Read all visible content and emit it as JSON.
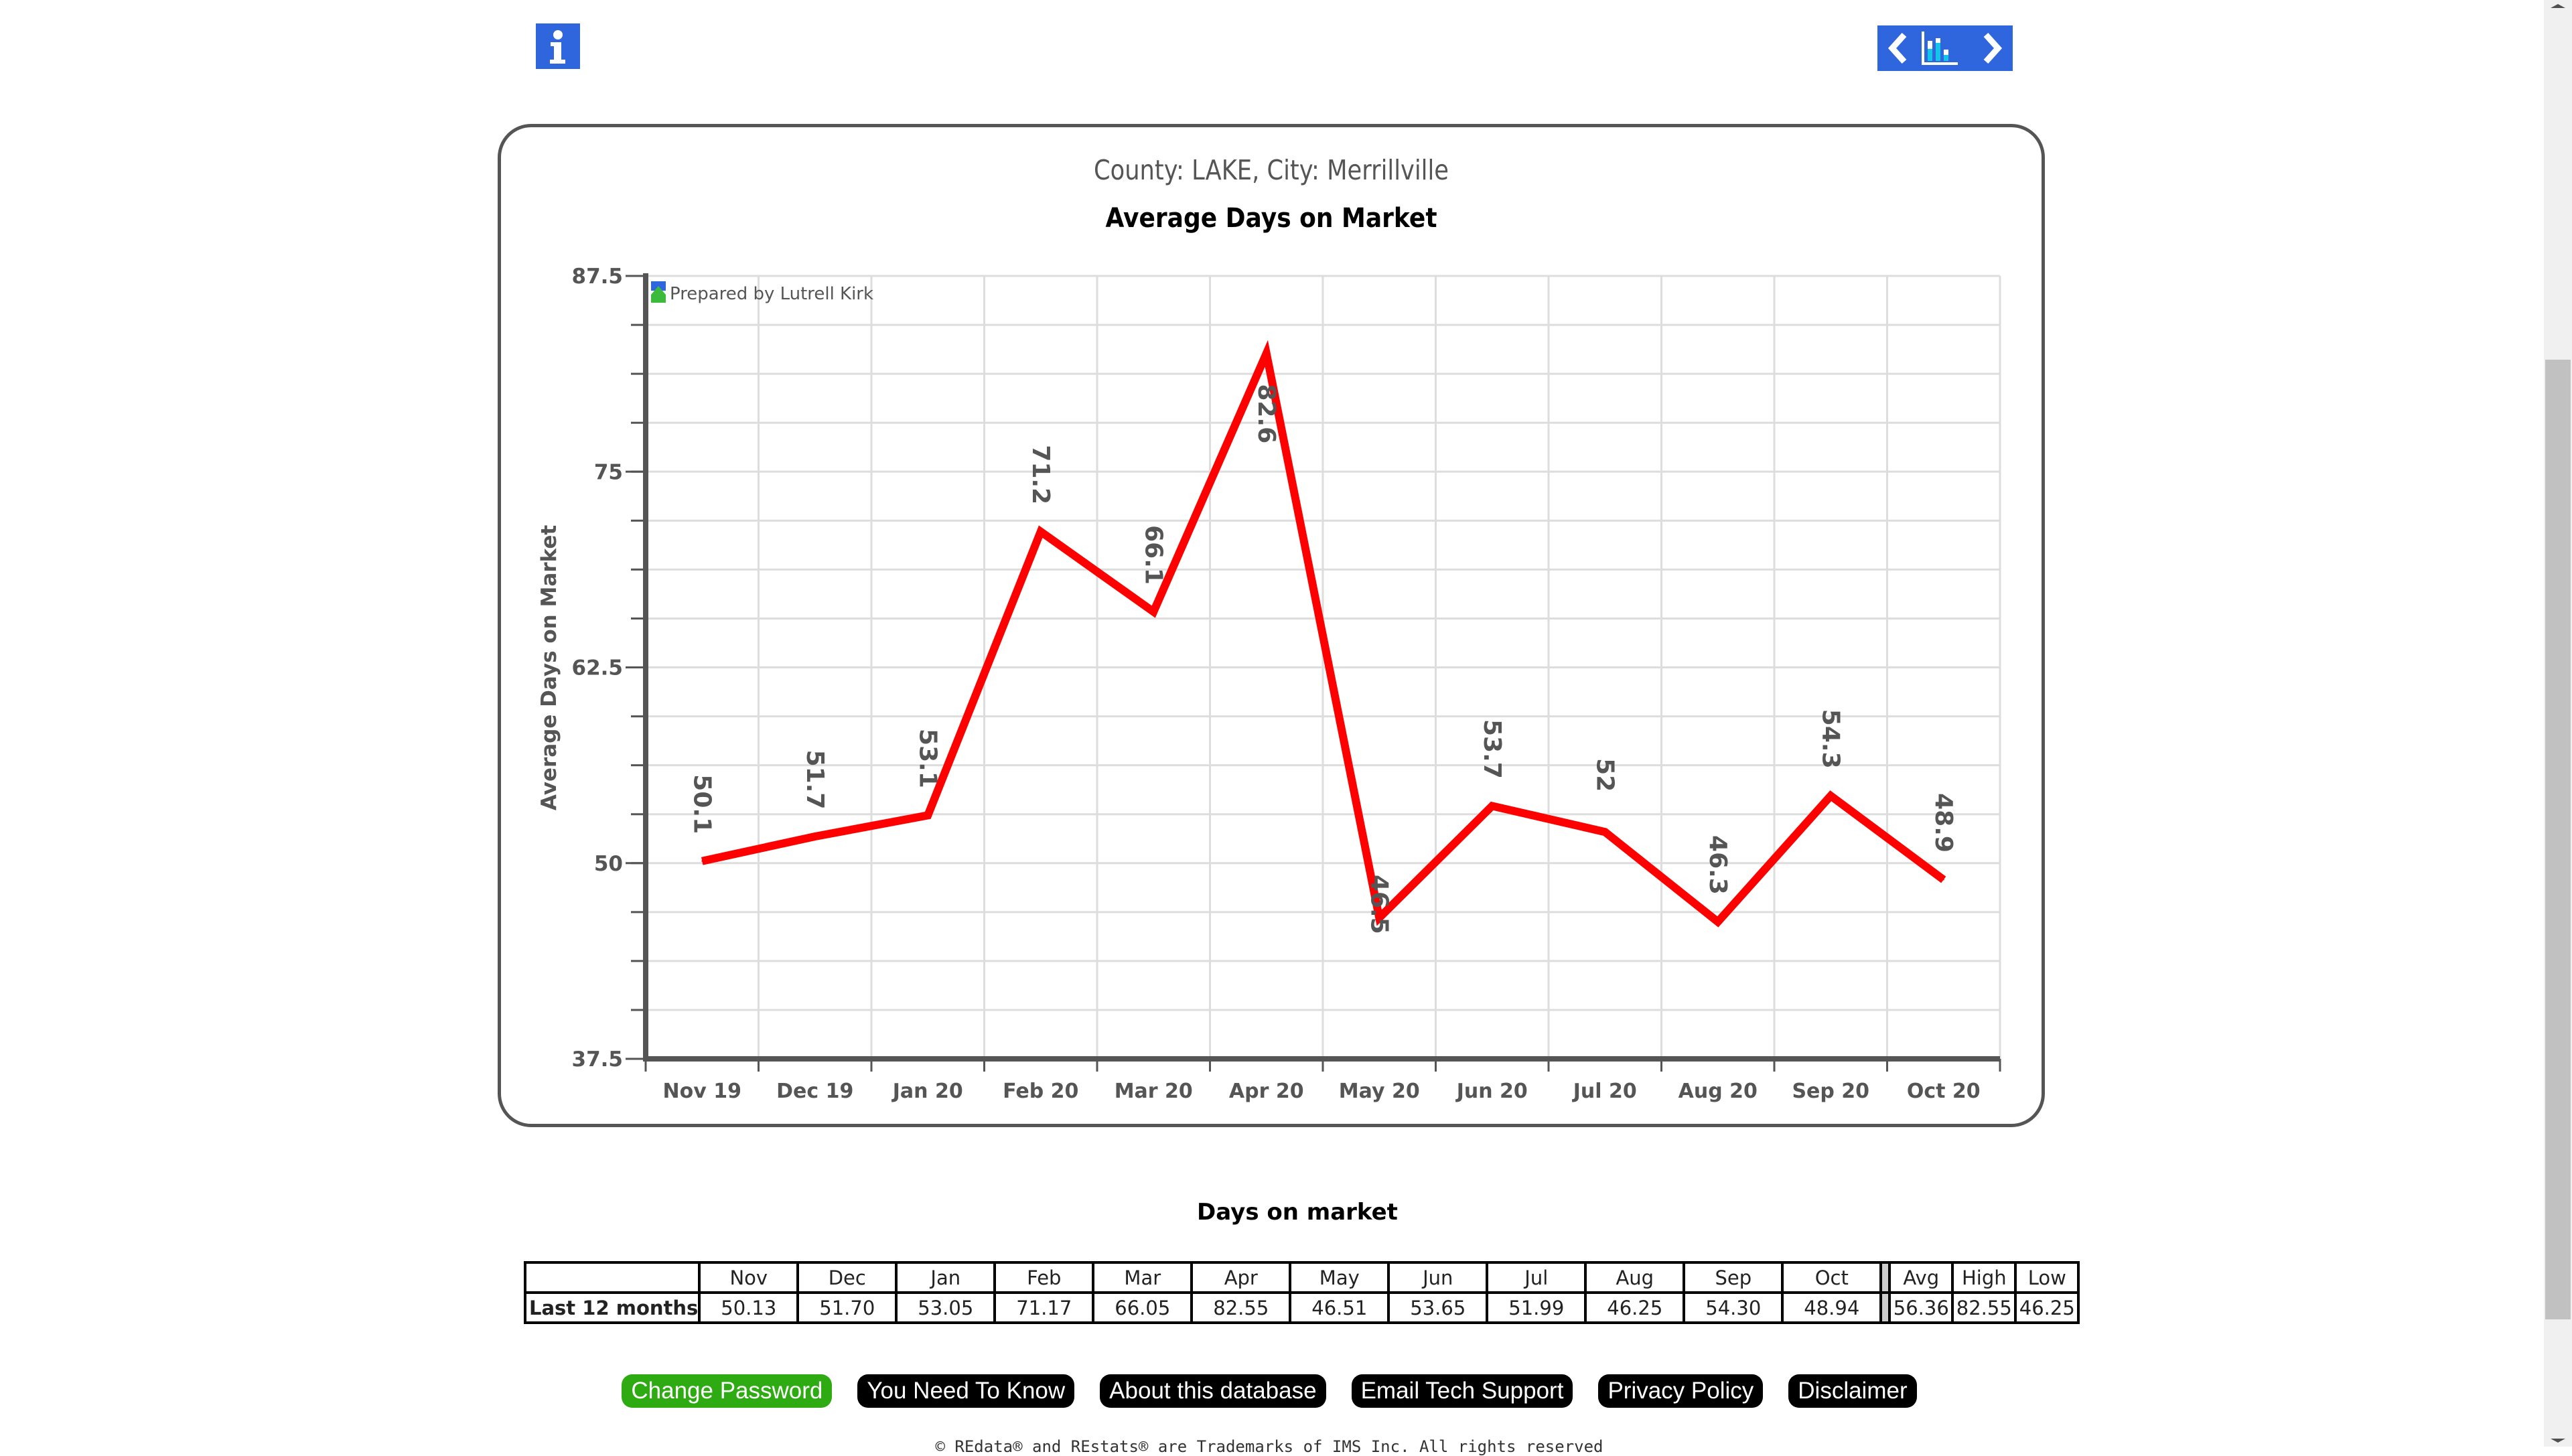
{
  "header": {
    "info_icon": "info-icon",
    "nav": {
      "prev_icon": "chevron-left-icon",
      "chart_icon": "bar-chart-icon",
      "next_icon": "chevron-right-icon"
    }
  },
  "chart_data": {
    "type": "line",
    "subtitle": "County: LAKE, City: Merrillville",
    "title": "Average Days on Market",
    "watermark": "Prepared by Lutrell Kirk",
    "xlabel": "",
    "ylabel": "Average Days on Market",
    "categories": [
      "Nov 19",
      "Dec 19",
      "Jan 20",
      "Feb 20",
      "Mar 20",
      "Apr 20",
      "May 20",
      "Jun 20",
      "Jul 20",
      "Aug 20",
      "Sep 20",
      "Oct 20"
    ],
    "series": [
      {
        "name": "Average Days on Market",
        "color": "#ff0000",
        "values": [
          50.13,
          51.7,
          53.05,
          71.17,
          66.05,
          82.55,
          46.51,
          53.65,
          51.99,
          46.25,
          54.3,
          48.94
        ],
        "labels": [
          "50.1",
          "51.7",
          "53.1",
          "71.2",
          "66.1",
          "82.6",
          "46.5",
          "53.7",
          "52",
          "46.3",
          "54.3",
          "48.9"
        ]
      }
    ],
    "ylim": [
      37.5,
      87.5
    ],
    "yticks": [
      37.5,
      50,
      62.5,
      75,
      87.5
    ],
    "ytick_labels": [
      "37.5",
      "50",
      "62.5",
      "75",
      "87.5"
    ],
    "minor_grid_step": 3.125,
    "grid": true,
    "legend": "none"
  },
  "table": {
    "title": "Days on market",
    "months": [
      "Nov",
      "Dec",
      "Jan",
      "Feb",
      "Mar",
      "Apr",
      "May",
      "Jun",
      "Jul",
      "Aug",
      "Sep",
      "Oct"
    ],
    "stat_headers": [
      "Avg",
      "High",
      "Low"
    ],
    "rows": [
      {
        "label": "Last 12 months",
        "values": [
          "50.13",
          "51.70",
          "53.05",
          "71.17",
          "66.05",
          "82.55",
          "46.51",
          "53.65",
          "51.99",
          "46.25",
          "54.30",
          "48.94"
        ],
        "stats": [
          "56.36",
          "82.55",
          "46.25"
        ]
      }
    ]
  },
  "footer": {
    "buttons": [
      {
        "label": "Change Password",
        "style": "green"
      },
      {
        "label": "You Need To Know",
        "style": "black"
      },
      {
        "label": "About this database",
        "style": "black"
      },
      {
        "label": "Email Tech Support",
        "style": "black"
      },
      {
        "label": "Privacy Policy",
        "style": "black"
      },
      {
        "label": "Disclaimer",
        "style": "black"
      }
    ],
    "copyright": "© REdata® and REstats® are Trademarks of IMS Inc. All rights reserved"
  },
  "colors": {
    "brand_blue": "#2f66dd",
    "line_red": "#ff0000",
    "button_green": "#2eaa13",
    "axis_gray": "#555555"
  }
}
